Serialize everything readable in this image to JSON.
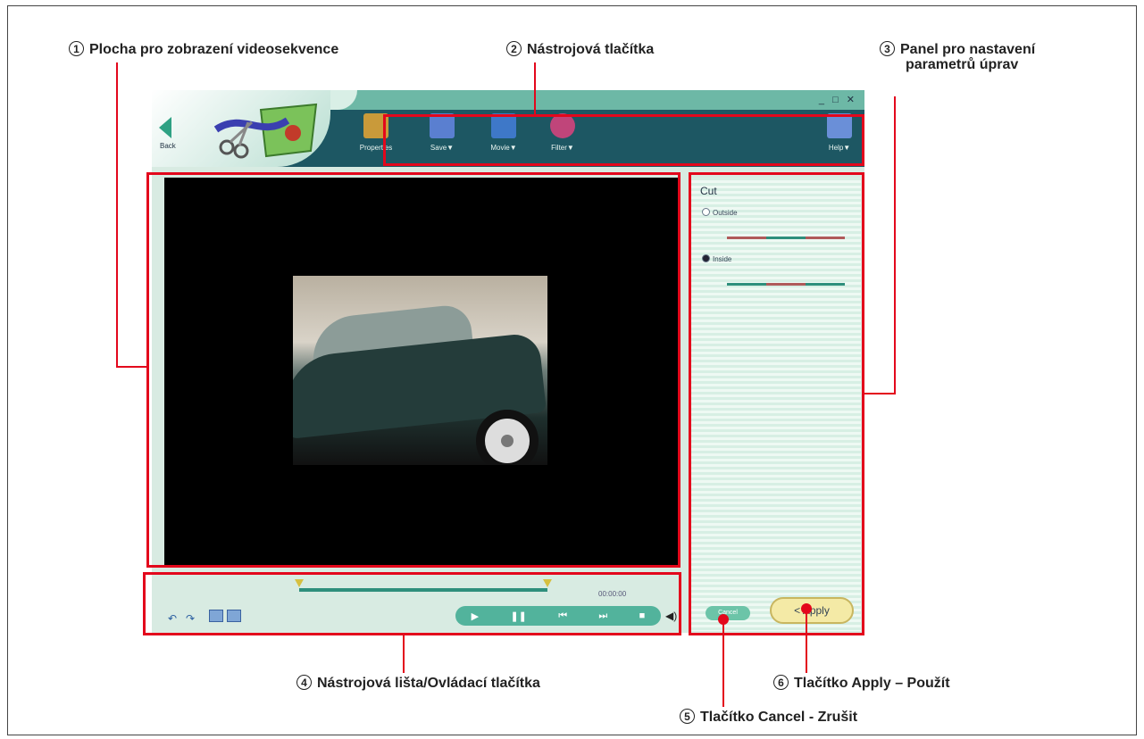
{
  "callouts": {
    "c1": {
      "num": "1",
      "text": "Plocha pro zobrazení videosekvence"
    },
    "c2": {
      "num": "2",
      "text": "Nástrojová tlačítka"
    },
    "c3": {
      "num": "3",
      "line1": "Panel pro nastavení",
      "line2": "parametrů úprav"
    },
    "c4": {
      "num": "4",
      "text": "Nástrojová lišta/Ovládací tlačítka"
    },
    "c5": {
      "num": "5",
      "text": "Tlačítko Cancel - Zrušit"
    },
    "c6": {
      "num": "6",
      "text": "Tlačítko Apply – Použít"
    }
  },
  "app": {
    "window_buttons": "_ □ ✕",
    "back_label": "Back",
    "toolbar": [
      {
        "label": "Properties",
        "icon": "info-icon",
        "color": "#c99a3a"
      },
      {
        "label": "Save▼",
        "icon": "floppy-disk-icon",
        "color": "#5a7fd0"
      },
      {
        "label": "Movie▼",
        "icon": "movie-icon",
        "color": "#3e78c8"
      },
      {
        "label": "Filter▼",
        "icon": "filter-icon",
        "color": "#c0457a"
      },
      {
        "label": "Help▼",
        "icon": "help-icon",
        "color": "#6a8fd8"
      }
    ],
    "timecode": "00:00:00",
    "transport": {
      "play": "▶",
      "pause": "❚❚",
      "prev": "⏮",
      "next": "⏭",
      "stop": "■"
    },
    "undo": "↶",
    "redo": "↷"
  },
  "panel": {
    "title": "Cut",
    "options": [
      {
        "label": "Outside",
        "selected": false
      },
      {
        "label": "Inside",
        "selected": true
      }
    ],
    "cancel_label": "Cancel",
    "apply_label": "Apply"
  },
  "colors": {
    "highlight": "#e3071c",
    "toolbar_bg": "#1d5763",
    "panel_bg": "#d7efe4"
  }
}
